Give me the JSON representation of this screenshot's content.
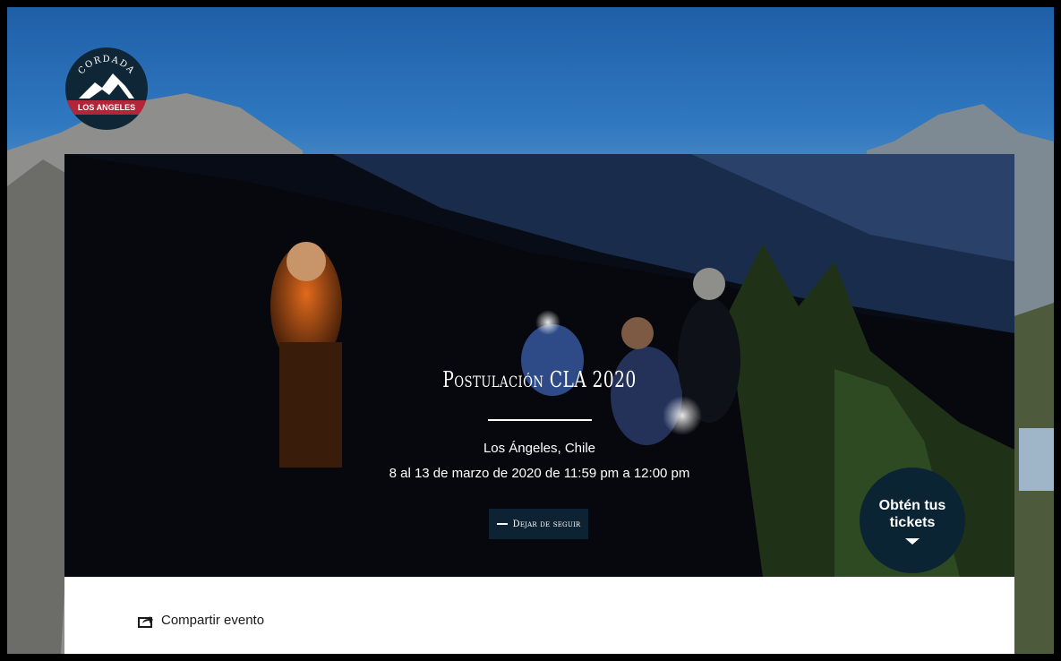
{
  "logo": {
    "top_text": "CORDADA",
    "band_text": "LOS ANGELES"
  },
  "event": {
    "title": "Postulación CLA 2020",
    "location": "Los Ángeles, Chile",
    "date": "8 al 13 de marzo de 2020 de 11:59 pm a 12:00 pm",
    "follow_label": "Dejar de seguir"
  },
  "tickets": {
    "label": "Obtén tus tickets"
  },
  "share": {
    "label": "Compartir evento",
    "icon": "share-icon"
  },
  "colors": {
    "dark_navy": "#0b2434",
    "logo_red": "#b3263a"
  }
}
